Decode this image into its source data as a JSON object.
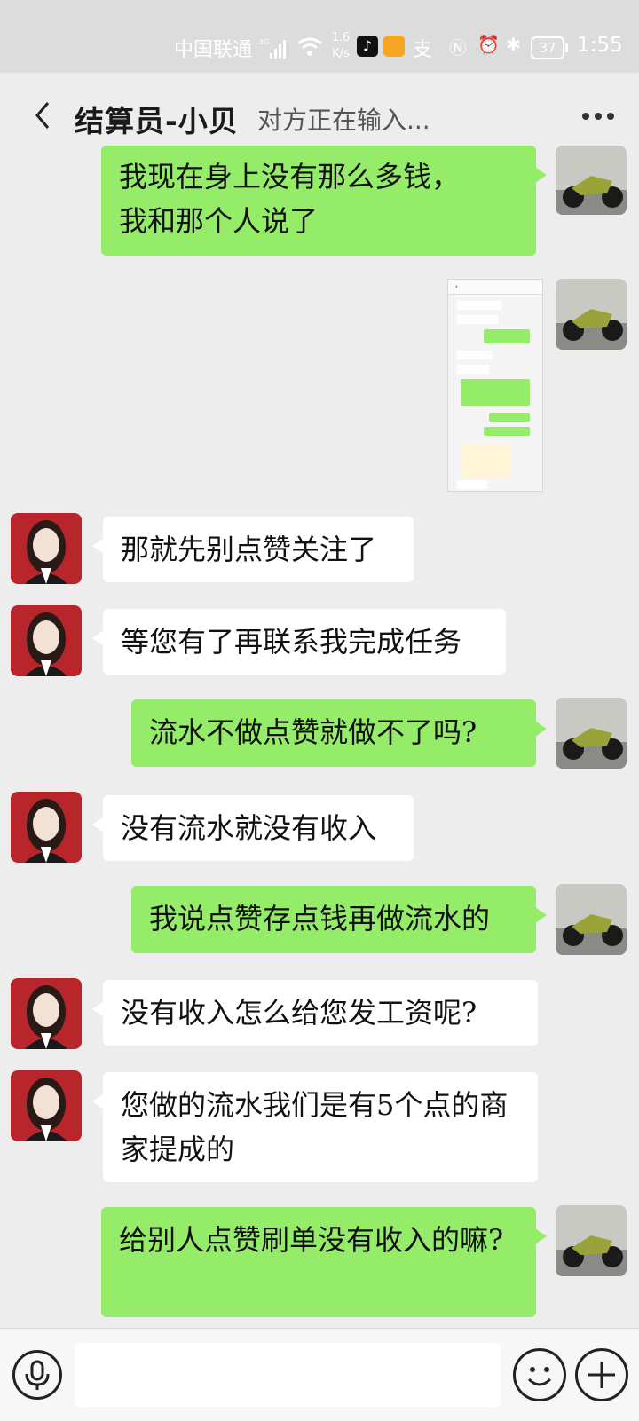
{
  "status_bar": {
    "carrier": "中国联通",
    "network": "3G",
    "speed_value": "1.6",
    "speed_unit": "K/s",
    "battery": "37",
    "time": "1:55"
  },
  "header": {
    "title": "结算员-小贝",
    "typing_status": "对方正在输入..."
  },
  "colors": {
    "sent_bubble": "#95ec69",
    "received_bubble": "#ffffff",
    "background": "#ededed"
  },
  "messages": [
    {
      "from": "me",
      "text": "我现在身上没有那么多钱，\n我和那个人说了"
    },
    {
      "from": "me",
      "type": "image"
    },
    {
      "from": "them",
      "text": "那就先别点赞关注了"
    },
    {
      "from": "them",
      "text": "等您有了再联系我完成任务"
    },
    {
      "from": "me",
      "text": "流水不做点赞就做不了吗?"
    },
    {
      "from": "them",
      "text": "没有流水就没有收入"
    },
    {
      "from": "me",
      "text": "我说点赞存点钱再做流水的"
    },
    {
      "from": "them",
      "text": "没有收入怎么给您发工资呢?"
    },
    {
      "from": "them",
      "text": "您做的流水我们是有5个点的商家提成的"
    },
    {
      "from": "me",
      "text": "给别人点赞刷单没有收入的嘛?"
    }
  ],
  "input_bar": {
    "voice_icon": "microphone-icon",
    "emoji_icon": "smiley-icon",
    "more_icon": "plus-icon"
  }
}
